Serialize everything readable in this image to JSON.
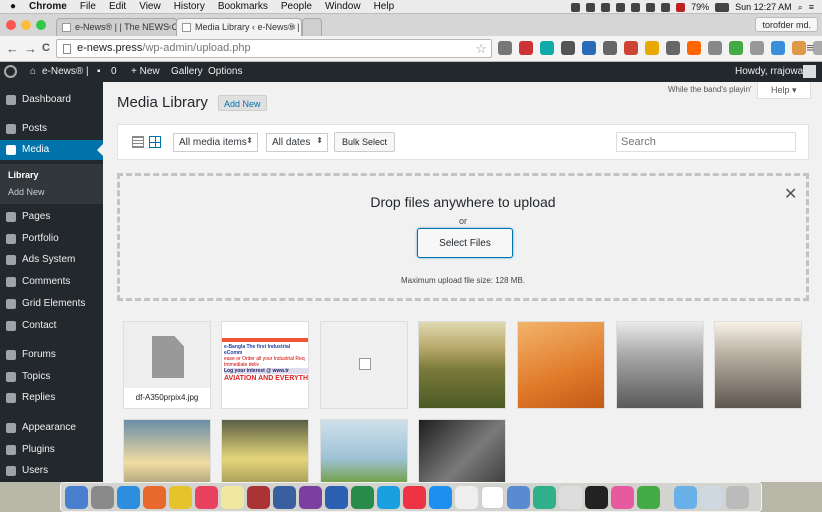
{
  "mac_menu": {
    "apple": "",
    "items": [
      "Chrome",
      "File",
      "Edit",
      "View",
      "History",
      "Bookmarks",
      "People",
      "Window",
      "Help"
    ],
    "battery": "79%",
    "clock": "Sun 12:27 AM"
  },
  "browser": {
    "tabs": [
      {
        "title": "e-News® | | The NEWS Co",
        "active": false
      },
      {
        "title": "Media Library ‹ e-News® |",
        "active": true
      }
    ],
    "profile": "torofder md.",
    "url_host": "e-news.press",
    "url_path": "/wp-admin/upload.php",
    "back": "←",
    "forward": "→",
    "reload": "C",
    "star": "☆",
    "menu": "≡"
  },
  "admin_bar": {
    "site": "e-News® |",
    "comments_count": "0",
    "new_label": "+ New",
    "gallery": "Gallery",
    "options": "Options",
    "howdy": "Howdy, rrajowan"
  },
  "sidebar": {
    "items": [
      {
        "label": "Dashboard",
        "icon": "dashboard-icon"
      },
      {
        "label": "Posts",
        "icon": "pin-icon"
      },
      {
        "label": "Media",
        "icon": "media-icon",
        "active": true
      },
      {
        "label": "Pages",
        "icon": "pages-icon"
      },
      {
        "label": "Portfolio",
        "icon": "portfolio-icon"
      },
      {
        "label": "Ads System",
        "icon": "ads-icon"
      },
      {
        "label": "Comments",
        "icon": "comments-icon"
      },
      {
        "label": "Grid Elements",
        "icon": "grid-icon"
      },
      {
        "label": "Contact",
        "icon": "mail-icon"
      },
      {
        "label": "Forums",
        "icon": "forums-icon"
      },
      {
        "label": "Topics",
        "icon": "topics-icon"
      },
      {
        "label": "Replies",
        "icon": "replies-icon"
      },
      {
        "label": "Appearance",
        "icon": "appearance-icon"
      },
      {
        "label": "Plugins",
        "icon": "plugins-icon"
      },
      {
        "label": "Users",
        "icon": "users-icon"
      }
    ],
    "submenu": [
      "Library",
      "Add New"
    ]
  },
  "main": {
    "title": "Media Library",
    "add_new": "Add New",
    "quote": "While the band's playin'",
    "help": "Help ▾",
    "filter_type": "All media items",
    "filter_date": "All dates",
    "bulk_select": "Bulk Select",
    "search_placeholder": "Search",
    "drop_text": "Drop files anywhere to upload",
    "or_text": "or",
    "select_files": "Select Files",
    "max_size": "Maximum upload file size: 128 MB.",
    "close": "✕",
    "first_file": "df-A350prpix4.jpg",
    "banner_lines": [
      "e-Bangla The first Industrial eComm",
      "ease or Order all your Industrial Req",
      "Immediate deliv",
      "Log your interest @ www.tr",
      "AVIATION AND EVERYTH"
    ]
  },
  "colors": {
    "wp_blue": "#0073aa",
    "admin_dark": "#23282d"
  }
}
